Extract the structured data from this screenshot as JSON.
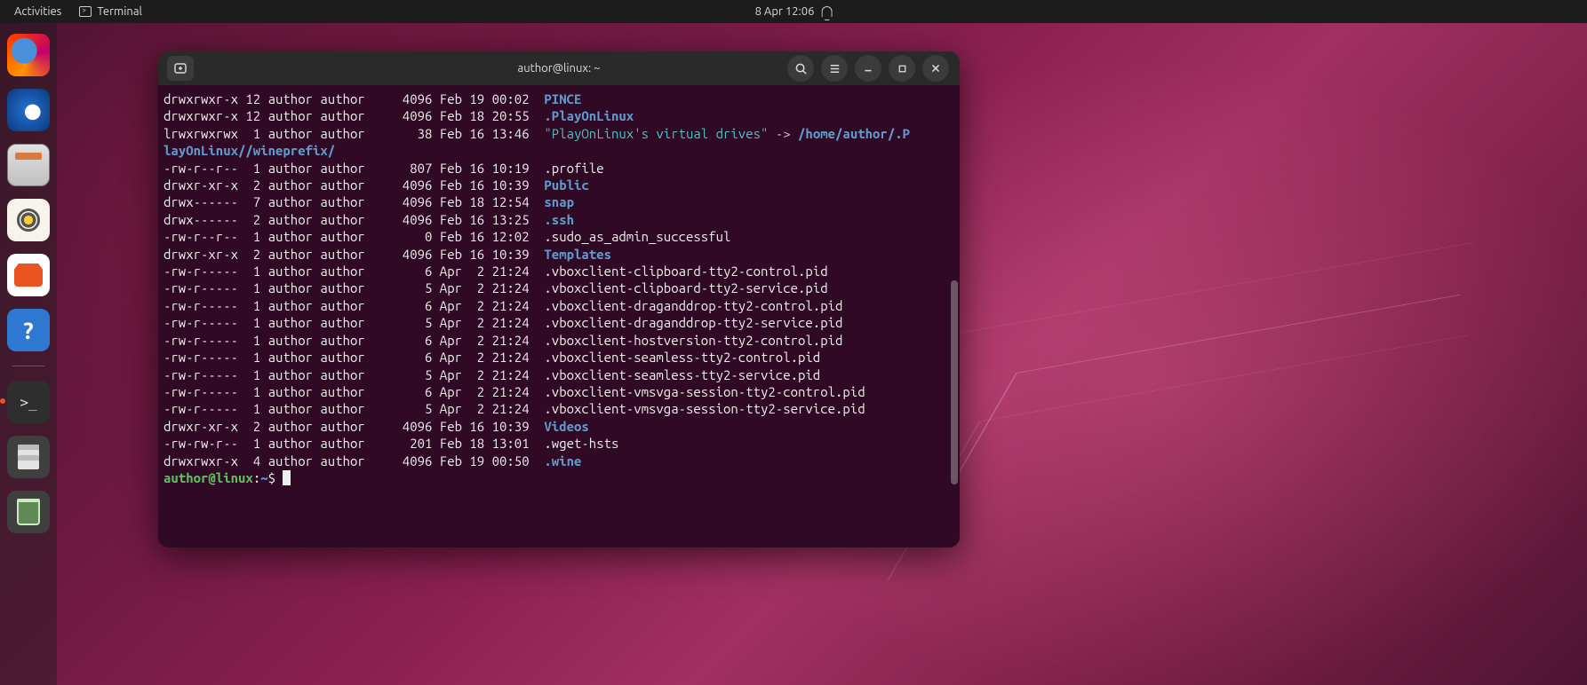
{
  "topbar": {
    "activities": "Activities",
    "appname": "Terminal",
    "clock": "8 Apr  12:06"
  },
  "dock": {
    "items": [
      {
        "name": "firefox",
        "label": "Firefox"
      },
      {
        "name": "thunderbird",
        "label": "Thunderbird"
      },
      {
        "name": "files",
        "label": "Files"
      },
      {
        "name": "rhythmbox",
        "label": "Rhythmbox"
      },
      {
        "name": "software",
        "label": "Ubuntu Software"
      },
      {
        "name": "help",
        "label": "Help"
      },
      {
        "name": "terminal",
        "label": "Terminal"
      },
      {
        "name": "texteditor",
        "label": "Text Editor"
      },
      {
        "name": "trash",
        "label": "Trash"
      }
    ]
  },
  "terminal": {
    "title": "author@linux: ~",
    "prompt": {
      "user": "author",
      "host": "linux",
      "path": "~",
      "sep": "$"
    },
    "symlink": {
      "quoted": "\"PlayOnLinux's virtual drives\"",
      "arrow": " -> ",
      "target": "/home/author/.PlayOnLinux//wineprefix/"
    },
    "listing": [
      {
        "perm": "drwxrwxr-x",
        "links": "12",
        "own": "author",
        "grp": "author",
        "size": "4096",
        "date": "Feb 19 00:02",
        "name": "PINCE",
        "cls": "dir"
      },
      {
        "perm": "drwxrwxr-x",
        "links": "12",
        "own": "author",
        "grp": "author",
        "size": "4096",
        "date": "Feb 18 20:55",
        "name": ".PlayOnLinux",
        "cls": "dir"
      },
      {
        "perm": "lrwxrwxrwx",
        "links": "1",
        "own": "author",
        "grp": "author",
        "size": "38",
        "date": "Feb 16 13:46",
        "name": "__SYMLINK__",
        "cls": "link"
      },
      {
        "perm": "-rw-r--r--",
        "links": "1",
        "own": "author",
        "grp": "author",
        "size": "807",
        "date": "Feb 16 10:19",
        "name": ".profile",
        "cls": "plain"
      },
      {
        "perm": "drwxr-xr-x",
        "links": "2",
        "own": "author",
        "grp": "author",
        "size": "4096",
        "date": "Feb 16 10:39",
        "name": "Public",
        "cls": "dir"
      },
      {
        "perm": "drwx------",
        "links": "7",
        "own": "author",
        "grp": "author",
        "size": "4096",
        "date": "Feb 18 12:54",
        "name": "snap",
        "cls": "dir"
      },
      {
        "perm": "drwx------",
        "links": "2",
        "own": "author",
        "grp": "author",
        "size": "4096",
        "date": "Feb 16 13:25",
        "name": ".ssh",
        "cls": "dir"
      },
      {
        "perm": "-rw-r--r--",
        "links": "1",
        "own": "author",
        "grp": "author",
        "size": "0",
        "date": "Feb 16 12:02",
        "name": ".sudo_as_admin_successful",
        "cls": "plain"
      },
      {
        "perm": "drwxr-xr-x",
        "links": "2",
        "own": "author",
        "grp": "author",
        "size": "4096",
        "date": "Feb 16 10:39",
        "name": "Templates",
        "cls": "dir"
      },
      {
        "perm": "-rw-r-----",
        "links": "1",
        "own": "author",
        "grp": "author",
        "size": "6",
        "date": "Apr  2 21:24",
        "name": ".vboxclient-clipboard-tty2-control.pid",
        "cls": "plain"
      },
      {
        "perm": "-rw-r-----",
        "links": "1",
        "own": "author",
        "grp": "author",
        "size": "5",
        "date": "Apr  2 21:24",
        "name": ".vboxclient-clipboard-tty2-service.pid",
        "cls": "plain"
      },
      {
        "perm": "-rw-r-----",
        "links": "1",
        "own": "author",
        "grp": "author",
        "size": "6",
        "date": "Apr  2 21:24",
        "name": ".vboxclient-draganddrop-tty2-control.pid",
        "cls": "plain"
      },
      {
        "perm": "-rw-r-----",
        "links": "1",
        "own": "author",
        "grp": "author",
        "size": "5",
        "date": "Apr  2 21:24",
        "name": ".vboxclient-draganddrop-tty2-service.pid",
        "cls": "plain"
      },
      {
        "perm": "-rw-r-----",
        "links": "1",
        "own": "author",
        "grp": "author",
        "size": "6",
        "date": "Apr  2 21:24",
        "name": ".vboxclient-hostversion-tty2-control.pid",
        "cls": "plain"
      },
      {
        "perm": "-rw-r-----",
        "links": "1",
        "own": "author",
        "grp": "author",
        "size": "6",
        "date": "Apr  2 21:24",
        "name": ".vboxclient-seamless-tty2-control.pid",
        "cls": "plain"
      },
      {
        "perm": "-rw-r-----",
        "links": "1",
        "own": "author",
        "grp": "author",
        "size": "5",
        "date": "Apr  2 21:24",
        "name": ".vboxclient-seamless-tty2-service.pid",
        "cls": "plain"
      },
      {
        "perm": "-rw-r-----",
        "links": "1",
        "own": "author",
        "grp": "author",
        "size": "6",
        "date": "Apr  2 21:24",
        "name": ".vboxclient-vmsvga-session-tty2-control.pid",
        "cls": "plain"
      },
      {
        "perm": "-rw-r-----",
        "links": "1",
        "own": "author",
        "grp": "author",
        "size": "5",
        "date": "Apr  2 21:24",
        "name": ".vboxclient-vmsvga-session-tty2-service.pid",
        "cls": "plain"
      },
      {
        "perm": "drwxr-xr-x",
        "links": "2",
        "own": "author",
        "grp": "author",
        "size": "4096",
        "date": "Feb 16 10:39",
        "name": "Videos",
        "cls": "dir"
      },
      {
        "perm": "-rw-rw-r--",
        "links": "1",
        "own": "author",
        "grp": "author",
        "size": "201",
        "date": "Feb 18 13:01",
        "name": ".wget-hsts",
        "cls": "plain"
      },
      {
        "perm": "drwxrwxr-x",
        "links": "4",
        "own": "author",
        "grp": "author",
        "size": "4096",
        "date": "Feb 19 00:50",
        "name": ".wine",
        "cls": "dir"
      }
    ]
  }
}
